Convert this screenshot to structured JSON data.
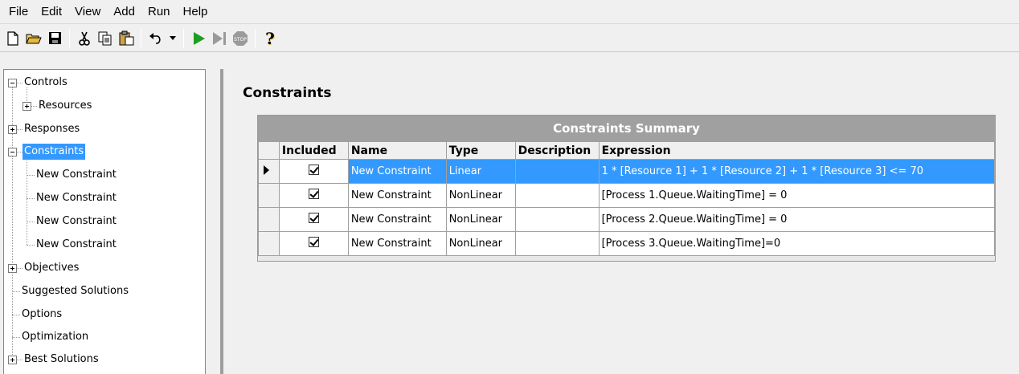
{
  "menu": {
    "items": [
      "File",
      "Edit",
      "View",
      "Add",
      "Run",
      "Help"
    ]
  },
  "toolbar": {
    "buttons": [
      "new-icon",
      "open-icon",
      "save-icon",
      "cut-icon",
      "copy-icon",
      "paste-icon",
      "undo-icon",
      "dropdown-icon",
      "run-icon",
      "step-icon",
      "stop-icon",
      "help-icon"
    ],
    "stop_label": "STOP",
    "help_glyph": "?",
    "run_color": "#1e9e1e",
    "disabled_color": "#9a9a9a"
  },
  "tree": {
    "controls": "Controls",
    "resources": "Resources",
    "responses": "Responses",
    "constraints": "Constraints",
    "constraint_children": [
      "New Constraint",
      "New Constraint",
      "New Constraint",
      "New Constraint"
    ],
    "objectives": "Objectives",
    "suggested_solutions": "Suggested Solutions",
    "options": "Options",
    "optimization": "Optimization",
    "best_solutions": "Best Solutions",
    "selected_color": "#3399ff"
  },
  "main": {
    "title": "Constraints",
    "grid": {
      "caption": "Constraints Summary",
      "columns": [
        "Included",
        "Name",
        "Type",
        "Description",
        "Expression"
      ],
      "rows": [
        {
          "included": true,
          "name": "New Constraint",
          "type": "Linear",
          "description": "",
          "expression": "1 * [Resource 1] + 1 * [Resource 2] + 1 * [Resource 3] <= 70",
          "selected": true
        },
        {
          "included": true,
          "name": "New Constraint",
          "type": "NonLinear",
          "description": "",
          "expression": "[Process 1.Queue.WaitingTime] = 0",
          "selected": false
        },
        {
          "included": true,
          "name": "New Constraint",
          "type": "NonLinear",
          "description": "",
          "expression": "[Process 2.Queue.WaitingTime] = 0",
          "selected": false
        },
        {
          "included": true,
          "name": "New Constraint",
          "type": "NonLinear",
          "description": "",
          "expression": "[Process 3.Queue.WaitingTime]=0",
          "selected": false
        }
      ]
    }
  }
}
